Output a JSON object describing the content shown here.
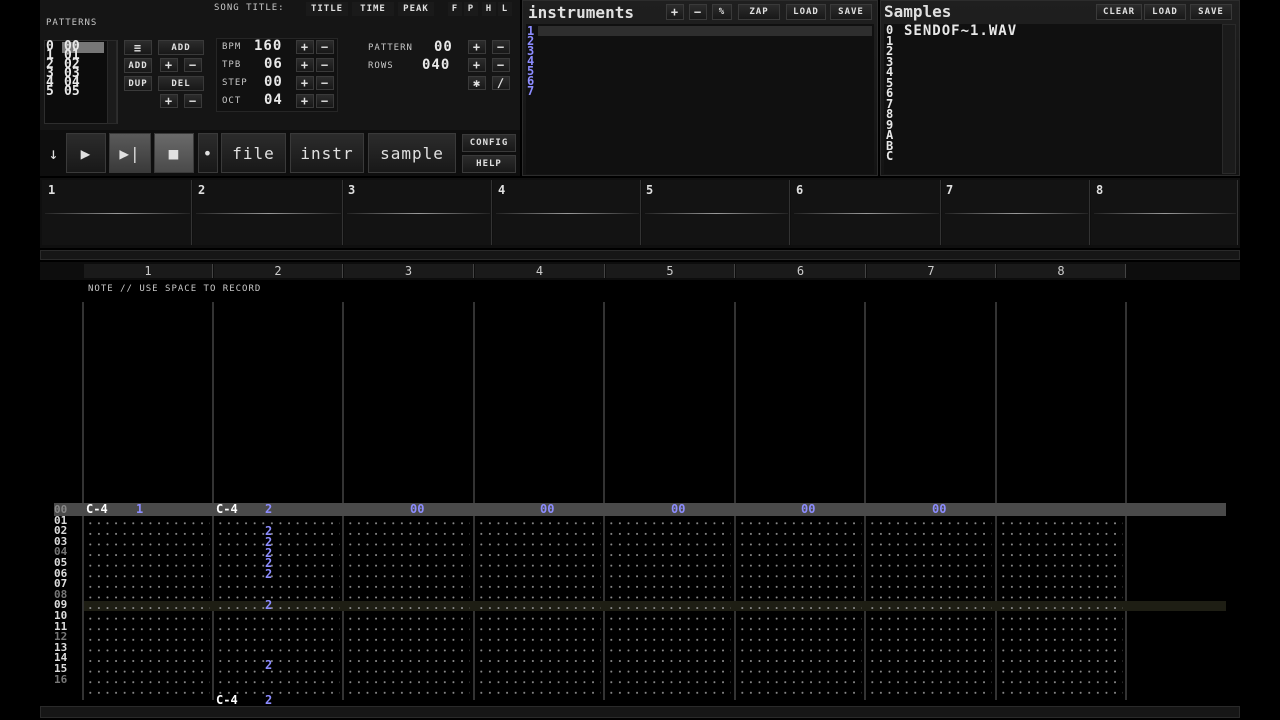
{
  "patterns_panel": {
    "title": "PATTERNS",
    "rows": [
      "0",
      "1",
      "2",
      "3",
      "4",
      "5"
    ],
    "values": [
      "00",
      "01",
      "02",
      "03",
      "04",
      "05"
    ],
    "buttons": {
      "menu": "≡",
      "add": "ADD",
      "add2": "ADD",
      "plus": "+",
      "minus": "−",
      "dup": "DUP",
      "del": "DEL",
      "plus2": "+",
      "minus2": "−"
    }
  },
  "song": {
    "title_label": "SONG TITLE:",
    "tabs": [
      "TITLE",
      "TIME",
      "PEAK"
    ],
    "flags": [
      "F",
      "P",
      "H",
      "L"
    ]
  },
  "params": [
    {
      "label": "BPM",
      "value": "160"
    },
    {
      "label": "TPB",
      "value": "06"
    },
    {
      "label": "STEP",
      "value": "00"
    },
    {
      "label": "OCT",
      "value": "04"
    }
  ],
  "pattern_info": {
    "pattern_label": "PATTERN",
    "pattern_value": "00",
    "rows_label": "ROWS",
    "rows_value": "040"
  },
  "transport": {
    "down": "↓",
    "play": "▶",
    "play_pattern": "▶|",
    "stop": "■",
    "dot": "•",
    "file": "file",
    "instr": "instr",
    "sample": "sample",
    "config": "CONFIG",
    "help": "HELP"
  },
  "instruments": {
    "title": "instruments",
    "buttons": [
      "+",
      "−",
      "%",
      "ZAP",
      "LOAD",
      "SAVE"
    ],
    "numbers": [
      "1",
      "2",
      "3",
      "4",
      "5",
      "6",
      "7"
    ]
  },
  "samples": {
    "title": "Samples",
    "buttons": [
      "CLEAR",
      "LOAD",
      "SAVE"
    ],
    "numbers": [
      "0",
      "1",
      "2",
      "3",
      "4",
      "5",
      "6",
      "7",
      "8",
      "9",
      "A",
      "B",
      "C"
    ],
    "first_name": "SENDOF~1.WAV"
  },
  "channels": [
    "1",
    "2",
    "3",
    "4",
    "5",
    "6",
    "7",
    "8"
  ],
  "status_text": "NOTE // USE SPACE TO RECORD",
  "pattern_rows": [
    "00",
    "01",
    "02",
    "03",
    "04",
    "05",
    "06",
    "07",
    "08",
    "09",
    "10",
    "11",
    "12",
    "13",
    "14",
    "15",
    "16"
  ],
  "cells": {
    "c1_note": "C-4",
    "c1_ins": "1",
    "c2_note": "C-4",
    "c2_ins": "2",
    "c2_r2": "2",
    "c2_r3": "2",
    "c2_r4": "2",
    "c2_r5": "2",
    "c2_r6": "2",
    "c2_r8": "2",
    "c2_r13": "2",
    "c2_r16_note": "C-4",
    "c2_r16_ins": "2",
    "vol": "00"
  },
  "colors": {
    "accent": "#8c8cff",
    "highlight_row": "#2a2a20",
    "current_row": "#4a4a4a"
  }
}
